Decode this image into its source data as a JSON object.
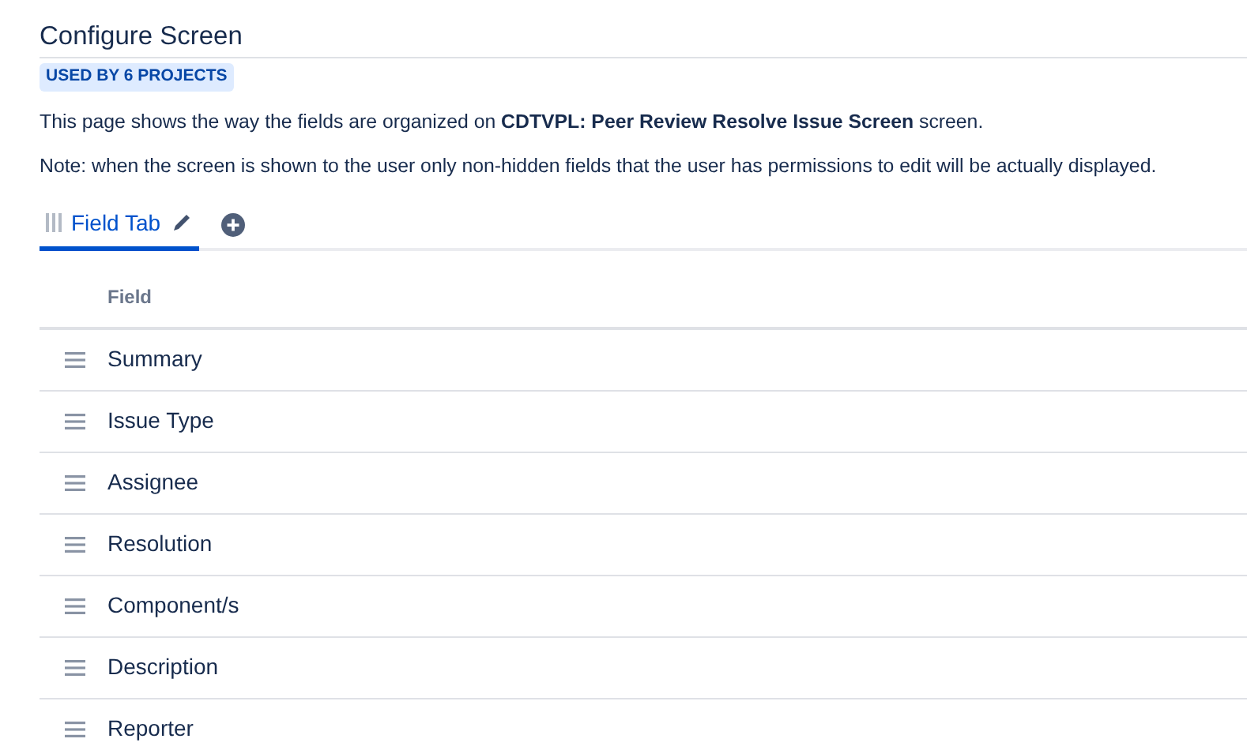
{
  "title": "Configure Screen",
  "badge": "USED BY 6 PROJECTS",
  "description": "This page shows the way the fields are organized on **CDTVPL: Peer Review Resolve Issue Screen** screen.",
  "note": "Note: when the screen is shown to the user only non-hidden fields that the user has permissions to edit will be actually displayed.",
  "tabs": [
    {
      "label": "Field Tab",
      "selected": true
    }
  ],
  "table": {
    "columns": [
      "Field"
    ],
    "rows": [
      {
        "field": "Summary"
      },
      {
        "field": "Issue Type"
      },
      {
        "field": "Assignee"
      },
      {
        "field": "Resolution"
      },
      {
        "field": "Component/s"
      },
      {
        "field": "Description"
      },
      {
        "field": "Reporter"
      }
    ]
  }
}
